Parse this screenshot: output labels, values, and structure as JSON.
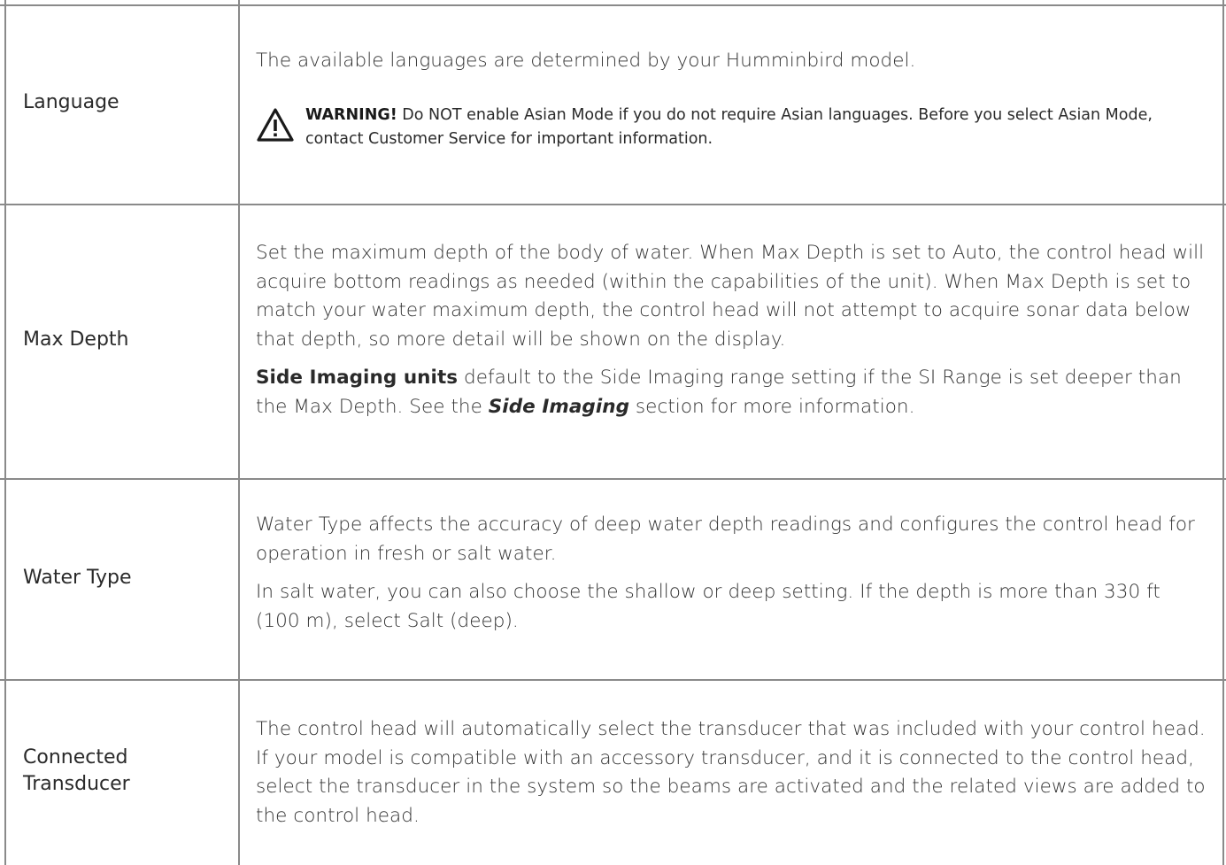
{
  "rows": [
    {
      "label": "Language",
      "description": "The available languages are determined by your Humminbird model.",
      "warning": {
        "icon": "warning-triangle-icon",
        "prefix": "WARNING!",
        "text": " Do NOT enable Asian Mode if you do not require Asian languages. Before you select Asian Mode, contact Customer Service for important information."
      }
    },
    {
      "label": "Max Depth",
      "paragraph1": "Set the maximum depth of the body of water. When Max Depth is set to Auto, the control head will acquire bottom readings as needed (within the capabilities of the unit). When Max Depth is set to match your water maximum depth, the control head will not attempt to acquire sonar data below that depth, so more detail will be shown on the display.",
      "p2_bold": "Side Imaging units",
      "p2_text1": " default to the Side Imaging range setting if the SI Range is set deeper than the Max Depth. See the ",
      "p2_italic": "Side Imaging",
      "p2_text2": " section for more information."
    },
    {
      "label": "Water Type",
      "paragraph1": "Water Type affects the accuracy of deep water depth readings and configures the control head for operation in fresh or salt water.",
      "paragraph2": "In salt water, you can also choose the shallow or deep setting. If the depth is more than 330 ft (100 m), select Salt (deep)."
    },
    {
      "label_line1": "Connected",
      "label_line2": "Transducer",
      "paragraph1": "The control head will automatically select the transducer that was included with your control head. If your model is compatible with an accessory transducer, and it is connected to the control head, select the transducer in the system so the beams are activated and the related views are added to the control head."
    }
  ],
  "colors": {
    "border": "#8a8a8a",
    "text": "#333333"
  }
}
